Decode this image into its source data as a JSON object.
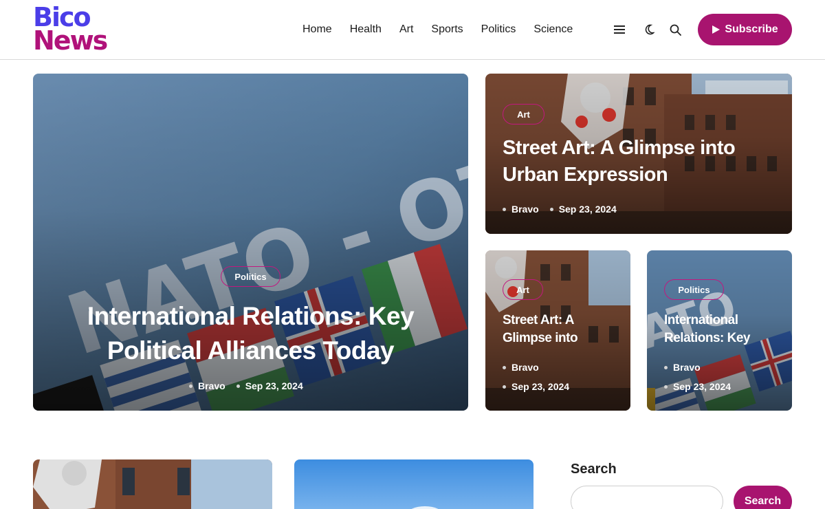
{
  "logo": {
    "line1": "Bico",
    "line2": "News"
  },
  "nav": {
    "items": [
      "Home",
      "Health",
      "Art",
      "Sports",
      "Politics",
      "Science"
    ]
  },
  "header_icons": [
    "menu-icon",
    "moon-icon",
    "search-icon"
  ],
  "subscribe": {
    "label": "Subscribe",
    "icon": "play-icon"
  },
  "featured": {
    "main": {
      "category": "Politics",
      "title_line1": "International Relations: Key",
      "title_line2": "Political Alliances Today",
      "author": "Bravo",
      "date": "Sep 23, 2024"
    },
    "top_right": {
      "category": "Art",
      "title_line1": "Street Art: A Glimpse into",
      "title_line2": "Urban Expression",
      "author": "Bravo",
      "date": "Sep 23, 2024"
    },
    "small_left": {
      "category": "Art",
      "title_line1": "Street Art: A",
      "title_line2": "Glimpse into",
      "author": "Bravo",
      "date": "Sep 23, 2024"
    },
    "small_right": {
      "category": "Politics",
      "title_line1": "International",
      "title_line2": "Relations: Key",
      "author": "Bravo",
      "date": "Sep 23, 2024"
    }
  },
  "sidebar": {
    "search_title": "Search",
    "search_placeholder": "",
    "search_button": "Search"
  },
  "colors": {
    "brand_blue": "#4b3ee8",
    "brand_magenta": "#a8146f",
    "pill_border": "#c2187f"
  }
}
